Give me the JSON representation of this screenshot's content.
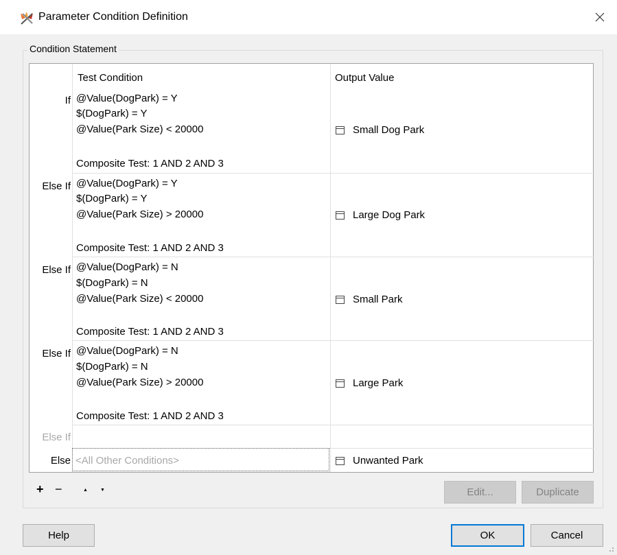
{
  "window": {
    "title": "Parameter Condition Definition"
  },
  "group": {
    "label": "Condition Statement"
  },
  "table": {
    "headers": {
      "test": "Test Condition",
      "output": "Output Value"
    },
    "rows": [
      {
        "keyword": "If",
        "lines": [
          "@Value(DogPark) = Y",
          "$(DogPark) = Y",
          "@Value(Park Size) < 20000"
        ],
        "composite": "Composite Test: 1 AND 2 AND 3",
        "output": "Small Dog Park"
      },
      {
        "keyword": "Else If",
        "lines": [
          "@Value(DogPark) = Y",
          "$(DogPark) = Y",
          "@Value(Park Size) > 20000"
        ],
        "composite": "Composite Test: 1 AND 2 AND 3",
        "output": "Large Dog Park"
      },
      {
        "keyword": "Else If",
        "lines": [
          "@Value(DogPark) = N",
          "$(DogPark) = N",
          "@Value(Park Size) < 20000"
        ],
        "composite": "Composite Test: 1 AND 2 AND 3",
        "output": "Small Park"
      },
      {
        "keyword": "Else If",
        "lines": [
          "@Value(DogPark) = N",
          "$(DogPark) = N",
          "@Value(Park Size) > 20000"
        ],
        "composite": "Composite Test: 1 AND 2 AND 3",
        "output": "Large Park"
      }
    ],
    "empty_row_keyword": "Else If",
    "else_row": {
      "keyword": "Else",
      "placeholder": "<All Other Conditions>",
      "output": "Unwanted Park"
    }
  },
  "toolbar": {
    "add": "+",
    "remove": "−",
    "move_up": "▲",
    "move_down": "▼"
  },
  "buttons": {
    "edit": "Edit...",
    "duplicate": "Duplicate",
    "help": "Help",
    "ok": "OK",
    "cancel": "Cancel"
  },
  "icons": {
    "app": "fme-workbench-icon",
    "close": "close-icon",
    "output_value": "output-value-icon"
  },
  "colors": {
    "accent": "#0078d7",
    "disabled_text": "#a8a8a8"
  }
}
